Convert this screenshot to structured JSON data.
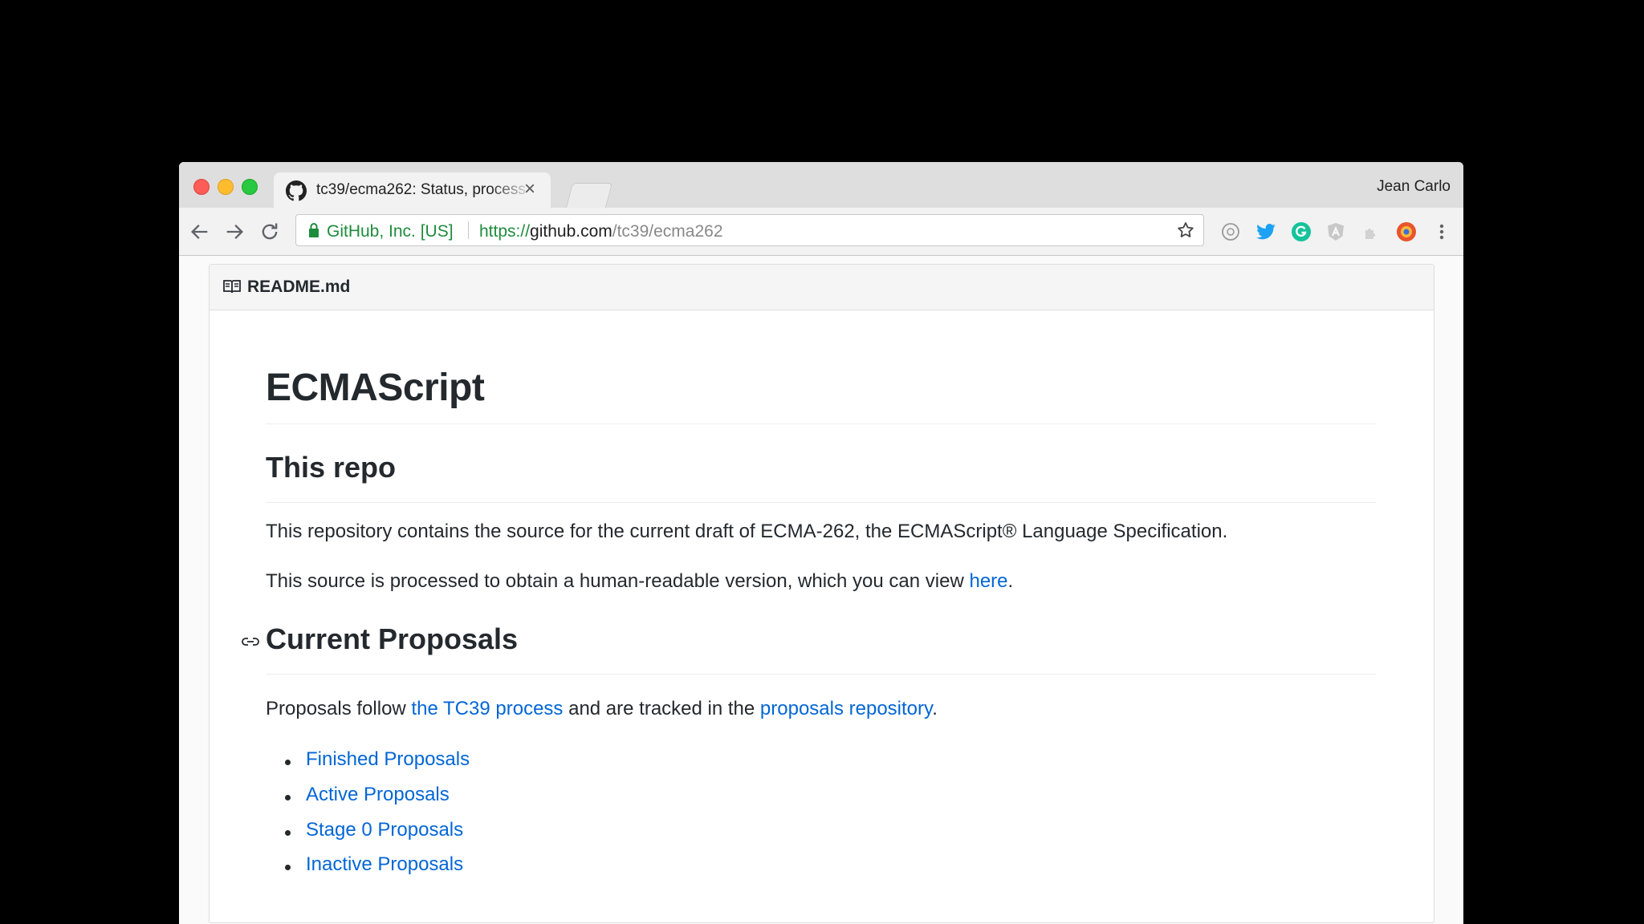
{
  "browser": {
    "tab_title": "tc39/ecma262: Status, process",
    "profile_name": "Jean Carlo",
    "site_identity": "GitHub, Inc. [US]",
    "url_scheme": "https://",
    "url_host": "github.com",
    "url_path": "/tc39/ecma262",
    "extensions": [
      "ext-circle-icon",
      "twitter-icon",
      "grammarly-icon",
      "angular-icon",
      "puzzle-icon",
      "color-picker-icon",
      "menu-dots-icon"
    ]
  },
  "readme": {
    "filename": "README.md",
    "title": "ECMAScript",
    "section1_heading": "This repo",
    "section1_p1": "This repository contains the source for the current draft of ECMA-262, the ECMAScript® Language Specification.",
    "section1_p2_before": "This source is processed to obtain a human-readable version, which you can view ",
    "section1_p2_link": "here",
    "section1_p2_after": ".",
    "section2_heading": "Current Proposals",
    "section2_p_before": "Proposals follow ",
    "section2_p_link1": "the TC39 process",
    "section2_p_middle": " and are tracked in the ",
    "section2_p_link2": "proposals repository",
    "section2_p_after": ".",
    "proposal_links": [
      "Finished Proposals",
      "Active Proposals",
      "Stage 0 Proposals",
      "Inactive Proposals"
    ]
  },
  "colors": {
    "link": "#0366d6",
    "secure_green": "#1e8c3c",
    "text": "#24292e"
  }
}
